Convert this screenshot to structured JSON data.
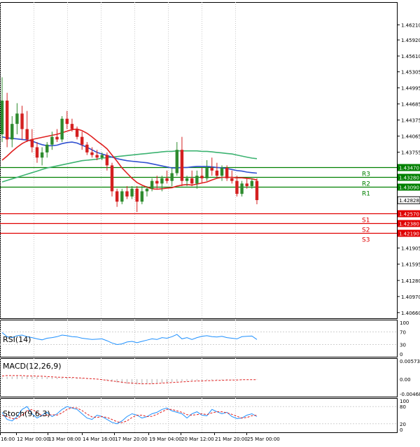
{
  "chart_data": {
    "type": "candlestick",
    "main": {
      "price_axis_labels": [
        "1.46210",
        "1.45920",
        "1.45610",
        "1.45305",
        "1.44995",
        "1.44685",
        "1.44375",
        "1.44065",
        "1.43755",
        "1.42828",
        "1.41905",
        "1.41595",
        "1.41280",
        "1.40970",
        "1.40660"
      ],
      "ylim": [
        1.4055,
        1.4665
      ],
      "levels": [
        {
          "name": "R3",
          "value": 1.4347,
          "label": "1.43470",
          "color": "#008000"
        },
        {
          "name": "R2",
          "value": 1.4328,
          "label": "1.43280",
          "color": "#008000"
        },
        {
          "name": "R1",
          "value": 1.4309,
          "label": "1.43090",
          "color": "#008000"
        },
        {
          "name": "S1",
          "value": 1.4257,
          "label": "1.42570",
          "color": "#e00000"
        },
        {
          "name": "S2",
          "value": 1.4238,
          "label": "1.42380",
          "color": "#e00000"
        },
        {
          "name": "S3",
          "value": 1.4219,
          "label": "1.42190",
          "color": "#e00000"
        }
      ],
      "current_price": {
        "value": 1.42828,
        "label": "1.42828"
      },
      "candles": [
        [
          1.441,
          1.452,
          1.4395,
          1.4475
        ],
        [
          1.4475,
          1.449,
          1.4385,
          1.44
        ],
        [
          1.44,
          1.4445,
          1.4385,
          1.443
        ],
        [
          1.443,
          1.447,
          1.441,
          1.445
        ],
        [
          1.445,
          1.4465,
          1.44,
          1.442
        ],
        [
          1.442,
          1.4455,
          1.4395,
          1.44
        ],
        [
          1.44,
          1.442,
          1.4375,
          1.4385
        ],
        [
          1.4385,
          1.4395,
          1.4355,
          1.4365
        ],
        [
          1.4365,
          1.4385,
          1.435,
          1.4375
        ],
        [
          1.4375,
          1.4395,
          1.4365,
          1.439
        ],
        [
          1.439,
          1.4415,
          1.438,
          1.4405
        ],
        [
          1.4405,
          1.442,
          1.4395,
          1.44
        ],
        [
          1.44,
          1.4445,
          1.4395,
          1.444
        ],
        [
          1.444,
          1.4455,
          1.442,
          1.443
        ],
        [
          1.443,
          1.444,
          1.4415,
          1.442
        ],
        [
          1.442,
          1.4425,
          1.44,
          1.4405
        ],
        [
          1.4405,
          1.4415,
          1.438,
          1.439
        ],
        [
          1.439,
          1.4395,
          1.437,
          1.4375
        ],
        [
          1.4375,
          1.4385,
          1.4365,
          1.437
        ],
        [
          1.437,
          1.438,
          1.436,
          1.4365
        ],
        [
          1.4365,
          1.4375,
          1.436,
          1.437
        ],
        [
          1.437,
          1.4375,
          1.434,
          1.435
        ],
        [
          1.435,
          1.4355,
          1.429,
          1.43
        ],
        [
          1.43,
          1.4305,
          1.427,
          1.428
        ],
        [
          1.428,
          1.4305,
          1.4275,
          1.43
        ],
        [
          1.43,
          1.431,
          1.4285,
          1.429
        ],
        [
          1.429,
          1.431,
          1.4285,
          1.4305
        ],
        [
          1.4305,
          1.431,
          1.426,
          1.428
        ],
        [
          1.428,
          1.431,
          1.4275,
          1.43
        ],
        [
          1.43,
          1.431,
          1.429,
          1.4305
        ],
        [
          1.4305,
          1.4325,
          1.43,
          1.432
        ],
        [
          1.432,
          1.433,
          1.4305,
          1.4315
        ],
        [
          1.4315,
          1.433,
          1.43,
          1.4325
        ],
        [
          1.4325,
          1.434,
          1.4315,
          1.432
        ],
        [
          1.432,
          1.4345,
          1.431,
          1.4335
        ],
        [
          1.4335,
          1.4395,
          1.433,
          1.438
        ],
        [
          1.438,
          1.4405,
          1.431,
          1.432
        ],
        [
          1.432,
          1.433,
          1.431,
          1.4325
        ],
        [
          1.4325,
          1.434,
          1.431,
          1.4315
        ],
        [
          1.4315,
          1.434,
          1.4305,
          1.433
        ],
        [
          1.433,
          1.4345,
          1.4315,
          1.4325
        ],
        [
          1.4325,
          1.436,
          1.432,
          1.4345
        ],
        [
          1.4345,
          1.4365,
          1.433,
          1.434
        ],
        [
          1.434,
          1.4355,
          1.4325,
          1.433
        ],
        [
          1.433,
          1.435,
          1.432,
          1.4345
        ],
        [
          1.4345,
          1.435,
          1.432,
          1.4325
        ],
        [
          1.4325,
          1.434,
          1.4315,
          1.432
        ],
        [
          1.432,
          1.433,
          1.429,
          1.4295
        ],
        [
          1.4295,
          1.432,
          1.429,
          1.4315
        ],
        [
          1.4315,
          1.4325,
          1.4305,
          1.431
        ],
        [
          1.431,
          1.4325,
          1.4305,
          1.432
        ],
        [
          1.432,
          1.4325,
          1.4275,
          1.4283
        ]
      ],
      "ma_blue": [
        1.4405,
        1.4403,
        1.4402,
        1.4401,
        1.44,
        1.4399,
        1.4397,
        1.4393,
        1.439,
        1.4388,
        1.4388,
        1.4389,
        1.4392,
        1.4394,
        1.4395,
        1.4393,
        1.4389,
        1.4385,
        1.438,
        1.4375,
        1.4372,
        1.4369,
        1.4366,
        1.4363,
        1.4361,
        1.4359,
        1.4358,
        1.4357,
        1.4356,
        1.4355,
        1.4353,
        1.4351,
        1.4349,
        1.4347,
        1.4345,
        1.4345,
        1.4346,
        1.4346,
        1.4347,
        1.4348,
        1.4348,
        1.4348,
        1.4347,
        1.4346,
        1.4345,
        1.4344,
        1.4342,
        1.434,
        1.4339,
        1.4337,
        1.4336,
        1.4335
      ],
      "ma_red": [
        1.436,
        1.4368,
        1.4377,
        1.4385,
        1.4392,
        1.4397,
        1.44,
        1.4402,
        1.4404,
        1.4406,
        1.4408,
        1.441,
        1.4413,
        1.4416,
        1.4419,
        1.442,
        1.4417,
        1.4412,
        1.4405,
        1.4397,
        1.439,
        1.4382,
        1.437,
        1.4358,
        1.4345,
        1.4335,
        1.4325,
        1.4317,
        1.4312,
        1.4308,
        1.4305,
        1.4304,
        1.4305,
        1.4306,
        1.4307,
        1.431,
        1.4312,
        1.4313,
        1.4312,
        1.4314,
        1.4316,
        1.4318,
        1.4322,
        1.4325,
        1.4327,
        1.4327,
        1.4327,
        1.4326,
        1.4326,
        1.4325,
        1.4324,
        1.4322
      ],
      "ma_green": [
        1.4318,
        1.4321,
        1.4324,
        1.4327,
        1.433,
        1.4333,
        1.4336,
        1.4339,
        1.4342,
        1.4345,
        1.4347,
        1.4349,
        1.4351,
        1.4353,
        1.4355,
        1.4357,
        1.4359,
        1.436,
        1.4361,
        1.4362,
        1.4364,
        1.4365,
        1.4366,
        1.4367,
        1.4368,
        1.4369,
        1.437,
        1.4371,
        1.4372,
        1.4373,
        1.4374,
        1.4375,
        1.4376,
        1.4377,
        1.4377,
        1.4378,
        1.4378,
        1.4378,
        1.4378,
        1.4378,
        1.4377,
        1.4377,
        1.4376,
        1.4375,
        1.4374,
        1.4373,
        1.4372,
        1.437,
        1.4368,
        1.4366,
        1.4364,
        1.4363
      ]
    },
    "rsi": {
      "title": "RSI(14)",
      "axis_labels": [
        "100",
        "70",
        "30",
        "0"
      ],
      "ylim": [
        0,
        100
      ],
      "values": [
        68,
        55,
        52,
        58,
        60,
        55,
        52,
        48,
        45,
        50,
        52,
        55,
        60,
        58,
        55,
        54,
        50,
        48,
        46,
        47,
        48,
        42,
        35,
        30,
        32,
        38,
        40,
        36,
        40,
        44,
        48,
        46,
        52,
        50,
        55,
        62,
        48,
        52,
        46,
        52,
        56,
        58,
        55,
        54,
        56,
        52,
        50,
        48,
        55,
        56,
        57,
        46
      ]
    },
    "macd": {
      "title": "MACD(12,26,9)",
      "axis_labels": [
        "0.005733",
        "0.00",
        "-0.00468"
      ],
      "ylim": [
        -0.00468,
        0.005733
      ],
      "histogram": [
        0.0005,
        0.0007,
        0.0008,
        0.0009,
        0.0009,
        0.001,
        0.0009,
        0.0008,
        0.0007,
        0.0006,
        0.0005,
        0.0005,
        0.0004,
        0.0004,
        0.0003,
        0.0003,
        0.0002,
        0.0001,
        0.0,
        -0.0001,
        -0.0003,
        -0.0005,
        -0.0008,
        -0.0011,
        -0.0013,
        -0.0015,
        -0.0016,
        -0.0017,
        -0.0017,
        -0.0016,
        -0.0015,
        -0.0013,
        -0.0012,
        -0.0011,
        -0.0009,
        -0.0008,
        -0.0007,
        -0.0006,
        -0.0005,
        -0.0004,
        -0.0004,
        -0.0003,
        -0.0003,
        -0.0002,
        -0.0002,
        -0.0002,
        -0.0001,
        -0.0001,
        -0.0001,
        0.0,
        0.0,
        -0.0001
      ],
      "signal": [
        0.001,
        0.0011,
        0.0011,
        0.0011,
        0.0011,
        0.001,
        0.001,
        0.0009,
        0.0009,
        0.0008,
        0.0007,
        0.0006,
        0.0006,
        0.0005,
        0.0005,
        0.0004,
        0.0003,
        0.0002,
        0.0001,
        0.0,
        -0.0002,
        -0.0004,
        -0.0006,
        -0.0008,
        -0.001,
        -0.0012,
        -0.0013,
        -0.0014,
        -0.0015,
        -0.0015,
        -0.0015,
        -0.0014,
        -0.0013,
        -0.0012,
        -0.0011,
        -0.001,
        -0.0009,
        -0.0008,
        -0.0007,
        -0.0006,
        -0.0006,
        -0.0005,
        -0.0005,
        -0.0004,
        -0.0004,
        -0.0003,
        -0.0003,
        -0.0003,
        -0.0002,
        -0.0002,
        -0.0002,
        -0.0002
      ]
    },
    "stoch": {
      "title": "Stoch(9,6,3)",
      "axis_labels": [
        "100",
        "80",
        "20",
        "0"
      ],
      "ylim": [
        0,
        100
      ],
      "k": [
        60,
        35,
        30,
        45,
        70,
        80,
        55,
        40,
        50,
        60,
        45,
        55,
        70,
        80,
        75,
        70,
        55,
        40,
        35,
        50,
        45,
        35,
        25,
        20,
        30,
        45,
        55,
        50,
        40,
        45,
        55,
        60,
        70,
        75,
        65,
        60,
        55,
        40,
        55,
        62,
        50,
        48,
        70,
        62,
        55,
        60,
        45,
        38,
        40,
        50,
        55,
        45
      ],
      "d": [
        50,
        45,
        38,
        38,
        50,
        65,
        70,
        60,
        48,
        50,
        52,
        50,
        58,
        70,
        76,
        75,
        66,
        54,
        44,
        42,
        45,
        42,
        35,
        27,
        24,
        30,
        42,
        50,
        50,
        45,
        46,
        53,
        62,
        70,
        70,
        65,
        60,
        52,
        50,
        52,
        55,
        52,
        58,
        62,
        62,
        58,
        53,
        46,
        40,
        42,
        48,
        50
      ]
    },
    "x_axis_labels": [
      "16:00",
      "12 Mar 00:00",
      "13 Mar 08:00",
      "14 Mar 16:00",
      "17 Mar 20:00",
      "19 Mar 04:00",
      "20 Mar 12:00",
      "21 Mar 20:00",
      "25 Mar 00:00"
    ]
  }
}
